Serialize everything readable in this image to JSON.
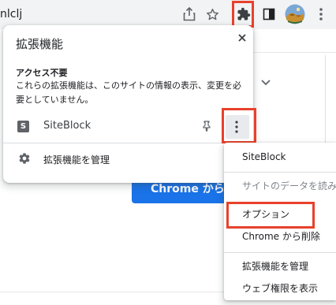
{
  "toolbar": {
    "url_fragment": "nlclj",
    "icons": [
      "share-icon",
      "bookmark-star-icon",
      "extensions-puzzle-icon",
      "side-panel-icon",
      "profile-avatar",
      "more-vert-icon"
    ]
  },
  "page": {
    "button_label": "Chrome から削除"
  },
  "extensions_popup": {
    "title": "拡張機能",
    "access_heading": "アクセス不要",
    "access_description": "これらの拡張機能は、このサイトの情報の表示、変更を必要としていません。",
    "extension": {
      "favicon_letter": "S",
      "name": "SiteBlock"
    },
    "manage_label": "拡張機能を管理"
  },
  "context_menu": {
    "items": [
      {
        "label": "SiteBlock",
        "disabled": false
      },
      {
        "label": "サイトのデータを読み取",
        "disabled": true
      },
      {
        "label": "オプション",
        "disabled": false
      },
      {
        "label": "Chrome から削除",
        "disabled": false
      },
      {
        "label": "拡張機能を管理",
        "disabled": false
      },
      {
        "label": "ウェブ権限を表示",
        "disabled": false
      }
    ]
  },
  "colors": {
    "highlight_red": "#e8412c",
    "primary_blue": "#1a73e8"
  }
}
